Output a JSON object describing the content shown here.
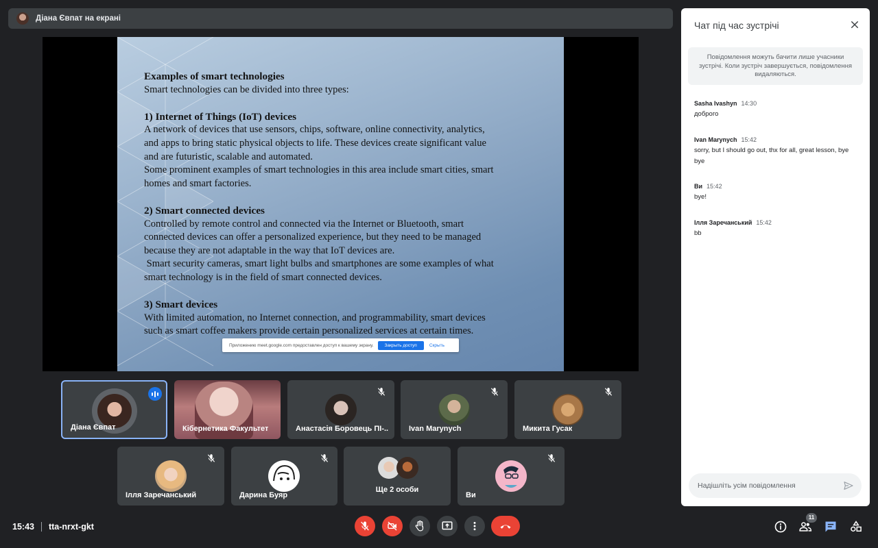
{
  "presenter": {
    "label": "Діана Євпат на екрані"
  },
  "slide": {
    "title": "Examples of smart technologies",
    "intro": "Smart technologies can be divided into three types:",
    "sections": [
      {
        "heading": "1) Internet of Things (IoT) devices",
        "lines": [
          "A network of devices that use sensors, chips, software, online connectivity, analytics,",
          "and apps to bring static physical objects to life. These devices create significant value",
          "and are futuristic, scalable and automated.",
          "Some prominent examples of smart technologies in this area include smart cities, smart",
          "homes and smart factories."
        ]
      },
      {
        "heading": "2) Smart connected devices",
        "lines": [
          "Controlled by remote control and connected via the Internet or Bluetooth, smart",
          "connected devices can offer a personalized experience, but they need to be managed",
          "because they are not adaptable in the way that IoT devices are.",
          " Smart security cameras, smart light bulbs and smartphones are some examples of what",
          "smart technology is in the field of smart connected devices."
        ]
      },
      {
        "heading": "3) Smart devices",
        "lines": [
          "With limited automation, no Internet connection, and programmability, smart devices",
          "such as smart coffee makers provide certain personalized services at certain times."
        ]
      }
    ],
    "share_notice": {
      "text": "Приложению meet.google.com предоставлен доступ к вашему экрану.",
      "stop_label": "Закрыть доступ",
      "hide_label": "Скрыть"
    }
  },
  "participants": [
    {
      "name": "Діана Євпат",
      "speaking": true
    },
    {
      "name": "Кібернетика Факультет",
      "muted": false
    },
    {
      "name": "Анастасія Боровець ПІ-...",
      "muted": true
    },
    {
      "name": "Ivan Marynych",
      "muted": true
    },
    {
      "name": "Микита Гусак",
      "muted": true
    },
    {
      "name": "Ілля Заречанський",
      "muted": true
    },
    {
      "name": "Дарина Буяр",
      "muted": true
    },
    {
      "name": "Ще 2 особи"
    },
    {
      "name": "Ви",
      "muted": true
    }
  ],
  "meeting": {
    "time": "15:43",
    "code": "tta-nrxt-gkt",
    "participant_count": "11"
  },
  "controls": [
    "microphone-off",
    "camera-off",
    "raise-hand",
    "present-screen",
    "more-options",
    "end-call"
  ],
  "right_controls": [
    "info",
    "people",
    "chat",
    "activities"
  ],
  "chat": {
    "title": "Чат під час зустрічі",
    "notice": "Повідомлення можуть бачити лише учасники зустрічі. Коли зустріч завершується, повідомлення видаляються.",
    "messages": [
      {
        "sender": "Sasha Ivashyn",
        "time": "14:30",
        "text": "доброго"
      },
      {
        "sender": "Ivan Marynych",
        "time": "15:42",
        "text": "sorry, but I should go out, thx for all,  great lesson, bye bye"
      },
      {
        "sender": "Ви",
        "time": "15:42",
        "text": "bye!"
      },
      {
        "sender": "Ілля Заречанський",
        "time": "15:42",
        "text": "bb"
      }
    ],
    "input_placeholder": "Надішліть усім повідомлення"
  },
  "colors": {
    "background": "#202124",
    "tile": "#3c4043",
    "accent": "#1a73e8",
    "danger": "#ea4335"
  }
}
